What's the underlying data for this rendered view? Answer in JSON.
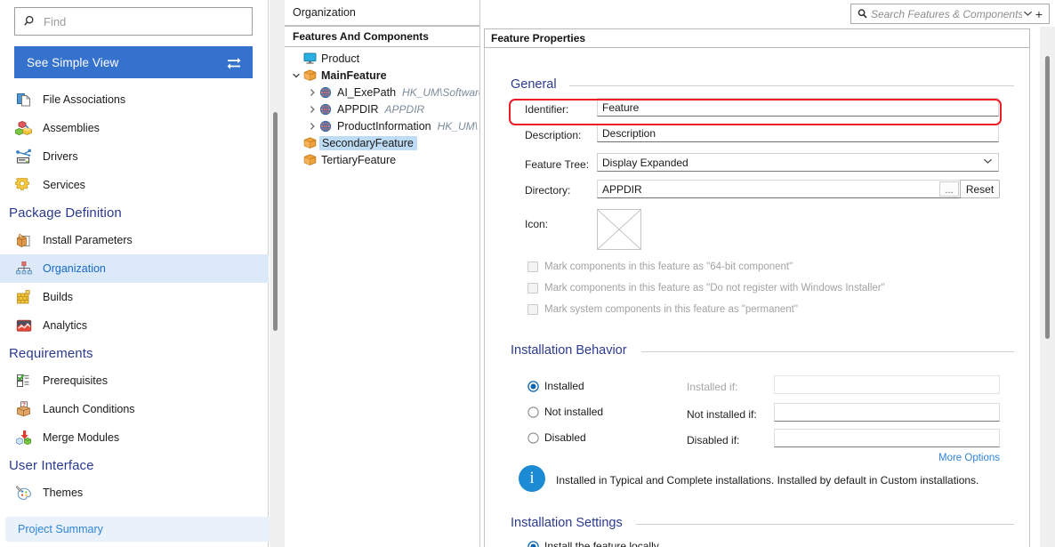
{
  "sidebar": {
    "find": {
      "placeholder": "Find",
      "icon": "search-icon"
    },
    "simple_view": {
      "label": "See Simple View",
      "icon": "swap-arrows-icon",
      "bg": "#3572ce"
    },
    "items": [
      {
        "label": "File Associations",
        "icon": "file-associations-icon",
        "type": "item",
        "selected": false
      },
      {
        "label": "Assemblies",
        "icon": "assemblies-icon",
        "type": "item",
        "selected": false
      },
      {
        "label": "Drivers",
        "icon": "drivers-icon",
        "type": "item",
        "selected": false
      },
      {
        "label": "Services",
        "icon": "services-icon",
        "type": "item",
        "selected": false
      },
      {
        "label": "Package Definition",
        "type": "group"
      },
      {
        "label": "Install Parameters",
        "icon": "install-parameters-icon",
        "type": "item",
        "selected": false
      },
      {
        "label": "Organization",
        "icon": "organization-icon",
        "type": "item",
        "selected": true
      },
      {
        "label": "Builds",
        "icon": "builds-icon",
        "type": "item",
        "selected": false
      },
      {
        "label": "Analytics",
        "icon": "analytics-icon",
        "type": "item",
        "selected": false
      },
      {
        "label": "Requirements",
        "type": "group"
      },
      {
        "label": "Prerequisites",
        "icon": "prerequisites-icon",
        "type": "item",
        "selected": false
      },
      {
        "label": "Launch Conditions",
        "icon": "launch-conditions-icon",
        "type": "item",
        "selected": false
      },
      {
        "label": "Merge Modules",
        "icon": "merge-modules-icon",
        "type": "item",
        "selected": false
      },
      {
        "label": "User Interface",
        "type": "group"
      },
      {
        "label": "Themes",
        "icon": "themes-icon",
        "type": "item",
        "selected": false
      }
    ],
    "project_summary": {
      "label": "Project Summary"
    }
  },
  "tree_panel": {
    "tab_label": "Organization",
    "header": "Features And Components",
    "rows": [
      {
        "label": "Product",
        "path": "",
        "icon": "monitor-icon",
        "indent": 0,
        "chevron": "",
        "bold": false,
        "selected": false
      },
      {
        "label": "MainFeature",
        "path": "",
        "icon": "feature-box-icon",
        "indent": 1,
        "chevron": "down",
        "bold": true,
        "selected": false
      },
      {
        "label": "AI_ExePath",
        "path": "HK_UM\\Software",
        "icon": "globe-icon",
        "indent": 2,
        "chevron": "right",
        "bold": false,
        "selected": false
      },
      {
        "label": "APPDIR",
        "path": "APPDIR",
        "icon": "globe-icon",
        "indent": 2,
        "chevron": "right",
        "bold": false,
        "selected": false
      },
      {
        "label": "ProductInformation",
        "path": "HK_UM\\",
        "icon": "globe-icon",
        "indent": 2,
        "chevron": "right",
        "bold": false,
        "selected": false
      },
      {
        "label": "SecondaryFeature",
        "path": "",
        "icon": "feature-box-icon",
        "indent": 1,
        "chevron": "",
        "bold": false,
        "selected": true
      },
      {
        "label": "TertiaryFeature",
        "path": "",
        "icon": "feature-box-icon",
        "indent": 1,
        "chevron": "",
        "bold": false,
        "selected": false
      }
    ]
  },
  "search": {
    "placeholder": "Search Features & Components",
    "icon": "search-icon",
    "dropdown_icon": "chevron-down-icon",
    "add_icon": "plus-icon"
  },
  "properties": {
    "tab_label": "Feature Properties",
    "general": {
      "title": "General",
      "identifier_label": "Identifier:",
      "identifier_value": "Feature",
      "description_label": "Description:",
      "description_value": "Description",
      "feature_tree_label": "Feature Tree:",
      "feature_tree_value": "Display Expanded",
      "feature_tree_options": [
        "Display Expanded"
      ],
      "directory_label": "Directory:",
      "directory_value": "APPDIR",
      "browse_label": "...",
      "reset_label": "Reset",
      "icon_label": "Icon:",
      "checkboxes": [
        {
          "label": "Mark components in this feature as \"64-bit component\"",
          "checked": false,
          "disabled": true
        },
        {
          "label": "Mark components in this feature as \"Do not register with Windows Installer\"",
          "checked": false,
          "disabled": true
        },
        {
          "label": "Mark system components in this feature as \"permanent\"",
          "checked": false,
          "disabled": true
        }
      ]
    },
    "installation_behavior": {
      "title": "Installation Behavior",
      "radios": [
        {
          "label": "Installed",
          "checked": true
        },
        {
          "label": "Not installed",
          "checked": false
        },
        {
          "label": "Disabled",
          "checked": false
        }
      ],
      "conditions": [
        {
          "label": "Installed if:",
          "value": "",
          "disabled": true
        },
        {
          "label": "Not installed if:",
          "value": "",
          "disabled": false
        },
        {
          "label": "Disabled if:",
          "value": "",
          "disabled": false
        }
      ],
      "more_options_label": "More Options",
      "info_icon": "info-icon",
      "info_text": "Installed in Typical and Complete installations. Installed by default in Custom installations."
    },
    "installation_settings": {
      "title": "Installation Settings",
      "first_option": "Install the feature locally"
    }
  },
  "highlight": {
    "color": "#ee1c25",
    "target": "identifier-row"
  }
}
